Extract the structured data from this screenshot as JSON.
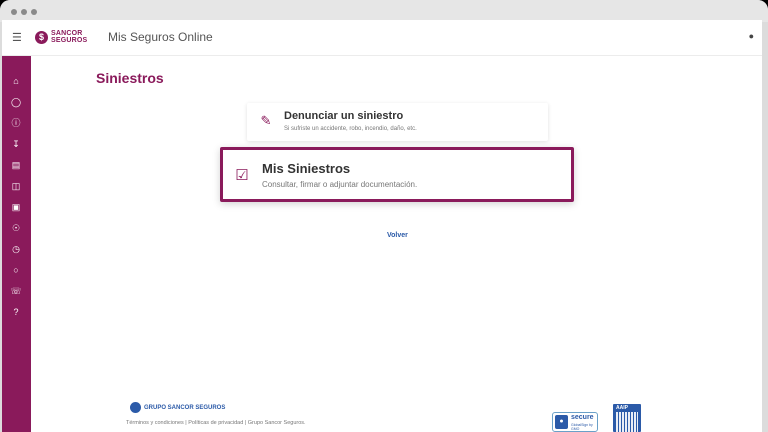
{
  "header": {
    "menu_icon": "hamburger-icon",
    "logo_mark": "$",
    "logo_line1": "SANCOR",
    "logo_line2": "SEGUROS",
    "app_title": "Mis Seguros Online",
    "user_icon": "user-icon"
  },
  "sidebar": {
    "icons": [
      "home-icon",
      "shield-icon",
      "alert-icon",
      "download-icon",
      "documents-icon",
      "car-icon",
      "gift-icon",
      "person-icon",
      "clock-icon",
      "chat-icon",
      "phone-icon",
      "help-icon"
    ]
  },
  "page": {
    "title": "Siniestros",
    "cards": [
      {
        "title": "Denunciar un siniestro",
        "subtitle": "Si sufriste un accidente, robo, incendio, daño, etc.",
        "icon": "edit-document-icon"
      },
      {
        "title": "Mis Siniestros",
        "subtitle": "Consultar, firmar o adjuntar documentación.",
        "icon": "document-check-icon"
      }
    ],
    "back_label": "Volver"
  },
  "footer": {
    "logo_text": "GRUPO SANCOR SEGUROS",
    "links": "Términos y condiciones | Políticas de privacidad | Grupo Sancor Seguros.",
    "secure_title": "secure",
    "secure_sub": "GlobalSign by GMO",
    "aaip_label": "AAIP"
  },
  "colors": {
    "brand": "#8a1a5b",
    "link": "#2b5aa8"
  }
}
